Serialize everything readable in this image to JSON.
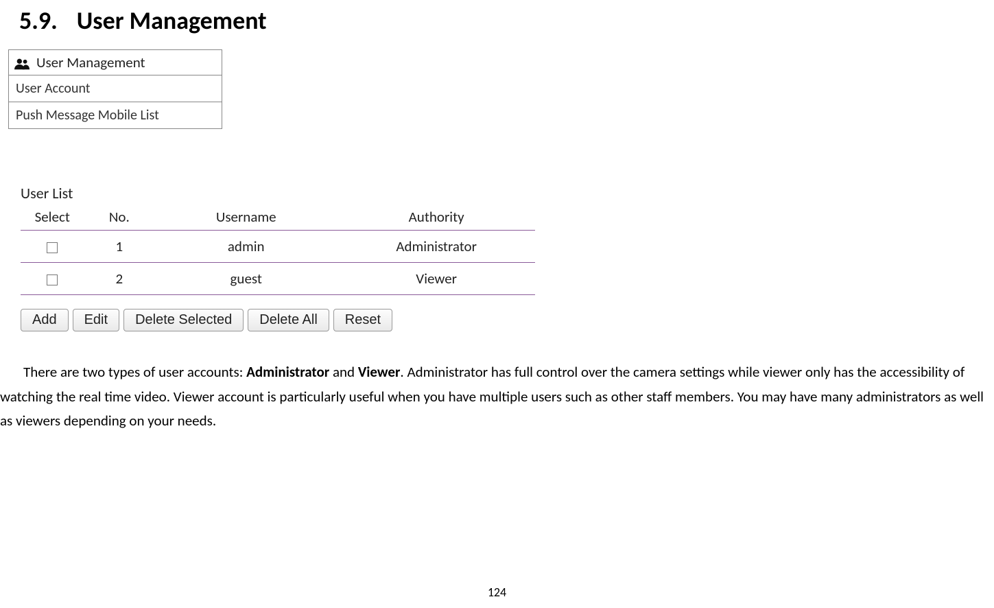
{
  "heading": {
    "number": "5.9.",
    "title": "User Management"
  },
  "nav": {
    "header": "User Management",
    "items": [
      "User Account",
      "Push Message Mobile List"
    ]
  },
  "user_list": {
    "title": "User List",
    "headers": {
      "select": "Select",
      "no": "No.",
      "username": "Username",
      "authority": "Authority"
    },
    "rows": [
      {
        "no": "1",
        "username": "admin",
        "authority": "Administrator"
      },
      {
        "no": "2",
        "username": "guest",
        "authority": "Viewer"
      }
    ],
    "buttons": {
      "add": "Add",
      "edit": "Edit",
      "delete_selected": "Delete Selected",
      "delete_all": "Delete All",
      "reset": "Reset"
    }
  },
  "paragraph": {
    "p1a": "There are two types of user accounts: ",
    "p1b": "Administrator",
    "p1c": " and ",
    "p1d": "Viewer",
    "p1e": ". Administrator has full control over the camera settings while viewer only has the accessibility of watching the real time video. Viewer account is particularly useful when you have multiple users such as other staff members. You may have many administrators as well as viewers depending on your needs."
  },
  "page_number": "124"
}
